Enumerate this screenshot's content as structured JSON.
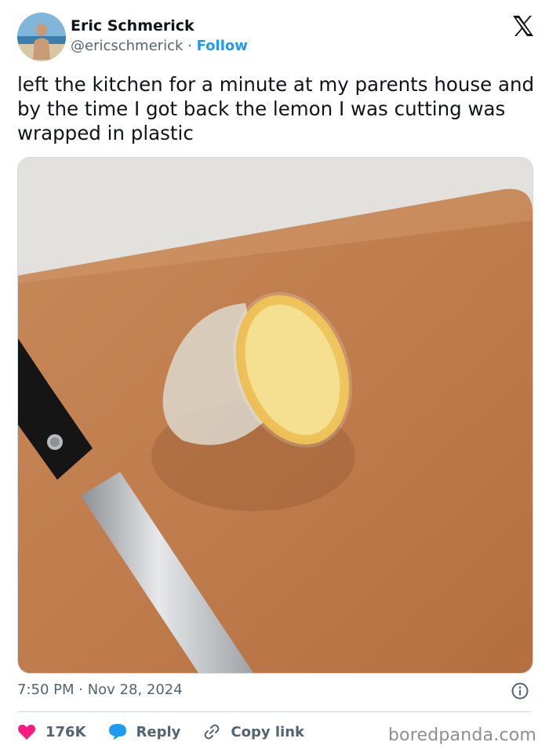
{
  "author": {
    "name": "Eric Schmerick",
    "handle": "@ericschmerick",
    "separator": "·",
    "follow_label": "Follow"
  },
  "tweet": {
    "text": "left the kitchen for a minute at my parents house and by the time I got back the lemon I was cutting was wrapped in plastic",
    "timestamp": "7:50 PM · Nov 28, 2024"
  },
  "actions": {
    "likes": "176K",
    "reply_label": "Reply",
    "copy_label": "Copy link"
  },
  "watermark": "boredpanda.com",
  "icons": {
    "platform": "x-logo-icon",
    "info": "info-icon",
    "like": "heart-icon",
    "reply": "speech-bubble-icon",
    "copy": "link-icon"
  },
  "colors": {
    "accent": "#1d9bf0",
    "like": "#f91880",
    "text": "#0f1419",
    "muted": "#536471"
  }
}
